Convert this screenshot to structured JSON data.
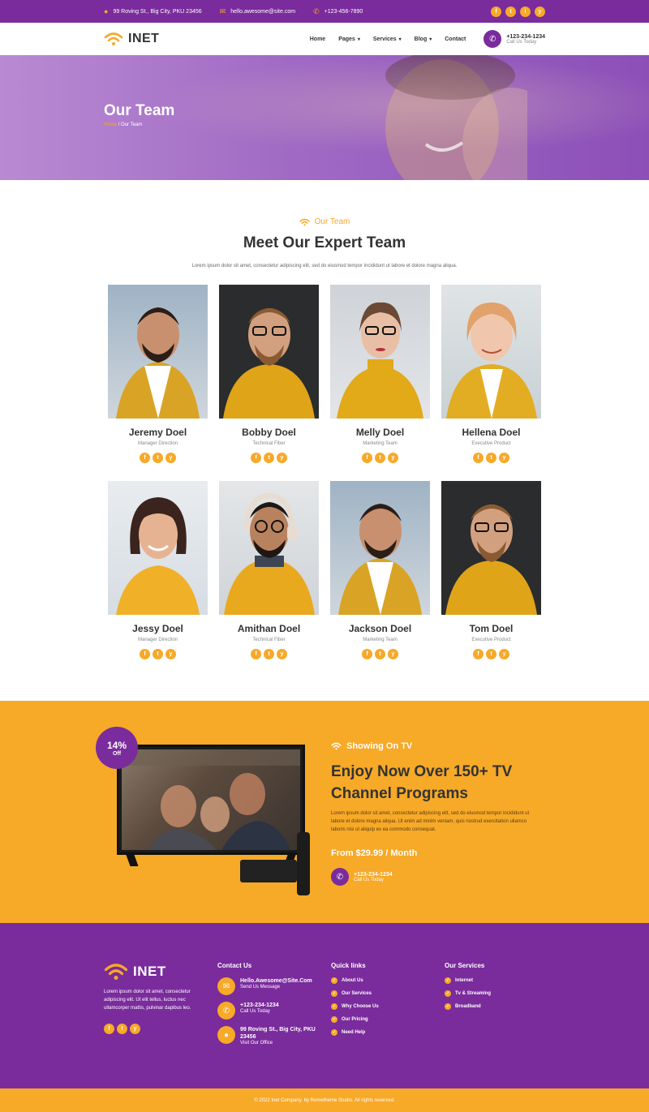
{
  "topbar": {
    "address": "99 Roving St., Big City, PKU 23456",
    "email": "hello.awesome@site.com",
    "phone": "+123-456-7890",
    "socials": [
      "f",
      "t",
      "i",
      "y"
    ]
  },
  "nav": {
    "brand": "INET",
    "items": [
      "Home",
      "Pages",
      "Services",
      "Blog",
      "Contact"
    ],
    "call_number": "+123-234-1234",
    "call_label": "Call Us Today"
  },
  "hero": {
    "title": "Our Team",
    "crumb_home": "Home",
    "crumb_current": "Our Team"
  },
  "team": {
    "eyebrow": "Our Team",
    "title": "Meet Our Expert Team",
    "lead": "Lorem ipsum dolor sit amet, consectetur adipiscing elit, sed do eiusmod tempor incididunt ut labore et dolore magna aliqua.",
    "members": [
      {
        "name": "Jeremy Doel",
        "role": "Manager Direction"
      },
      {
        "name": "Bobby Doel",
        "role": "Technical Fiber"
      },
      {
        "name": "Melly Doel",
        "role": "Marketing Team"
      },
      {
        "name": "Hellena Doel",
        "role": "Executive Product"
      },
      {
        "name": "Jessy Doel",
        "role": "Manager Direction"
      },
      {
        "name": "Amithan Doel",
        "role": "Technical Fiber"
      },
      {
        "name": "Jackson Doel",
        "role": "Marketing Team"
      },
      {
        "name": "Tom Doel",
        "role": "Executive Product"
      }
    ]
  },
  "promo": {
    "badge_percent": "14%",
    "badge_off": "Off",
    "eyebrow": "Showing On TV",
    "title": "Enjoy Now Over 150+ TV Channel Programs",
    "desc": "Lorem ipsum dolor sit amet, consectetur adipiscing elit, sed do eiusmod tempor incididunt ut labore et dolore magna aliqua. Ut enim ad minim veniam, quis nostrud exercitation ullamco laboris nisi ut aliquip ex ea commodo consequat.",
    "price": "From $29.99 / Month",
    "call_number": "+123-234-1234",
    "call_label": "Call Us Today"
  },
  "footer": {
    "brand": "INET",
    "about": "Lorem ipsum dolor sit amet, consectetur adipiscing elit. Ut elit tellus, luctus nec ullamcorper mattis, pulvinar dapibus leo.",
    "contact_title": "Contact Us",
    "contact": [
      {
        "t1": "Hello.Awesome@Site.Com",
        "t2": "Send Us Message"
      },
      {
        "t1": "+123-234-1234",
        "t2": "Call Us Today"
      },
      {
        "t1": "99 Roving St., Big City, PKU 23456",
        "t2": "Visit Our Office"
      }
    ],
    "links_title": "Quick links",
    "links": [
      "About Us",
      "Our Services",
      "Why Choose Us",
      "Our Pricing",
      "Need Help"
    ],
    "services_title": "Our Services",
    "services": [
      "Internet",
      "Tv & Streaming",
      "Broadband"
    ],
    "copyright": "© 2022 Inet Company. by Rometheme Studio. All rights reserved.",
    "colors": {
      "purple": "#7a2b9c",
      "orange": "#f7a928"
    }
  }
}
